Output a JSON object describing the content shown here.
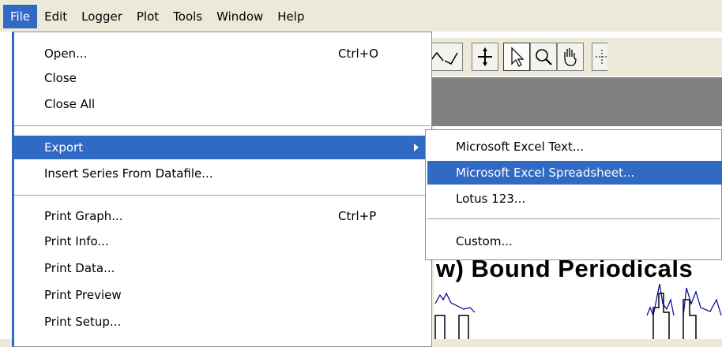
{
  "menubar": {
    "items": [
      "File",
      "Edit",
      "Logger",
      "Plot",
      "Tools",
      "Window",
      "Help"
    ]
  },
  "file_menu": {
    "items": [
      {
        "label": "Open...",
        "shortcut": "Ctrl+O"
      },
      {
        "label": "Close"
      },
      {
        "label": "Close All"
      },
      {
        "label": "Export"
      },
      {
        "label": "Insert Series From Datafile..."
      },
      {
        "label": "Print Graph...",
        "shortcut": "Ctrl+P"
      },
      {
        "label": "Print Info..."
      },
      {
        "label": "Print Data..."
      },
      {
        "label": "Print Preview"
      },
      {
        "label": "Print Setup..."
      }
    ],
    "highlighted": "Export"
  },
  "export_submenu": {
    "items": [
      {
        "label": "Microsoft Excel Text..."
      },
      {
        "label": "Microsoft Excel Spreadsheet..."
      },
      {
        "label": "Lotus 123..."
      },
      {
        "label": "Custom..."
      }
    ],
    "highlighted": "Microsoft Excel Spreadsheet..."
  },
  "plot": {
    "title_partial": "w) Bound Periodicals"
  },
  "colors": {
    "highlight": "#316ac5",
    "menubar_bg": "#ece9d8",
    "menu_bg": "#ffffff",
    "plot_line": "#00008b"
  },
  "icons": [
    "curve-down-icon",
    "curve-up-icon",
    "crosshair-icon",
    "pointer-icon",
    "zoom-icon",
    "pan-hand-icon",
    "cursor-tool-icon"
  ]
}
